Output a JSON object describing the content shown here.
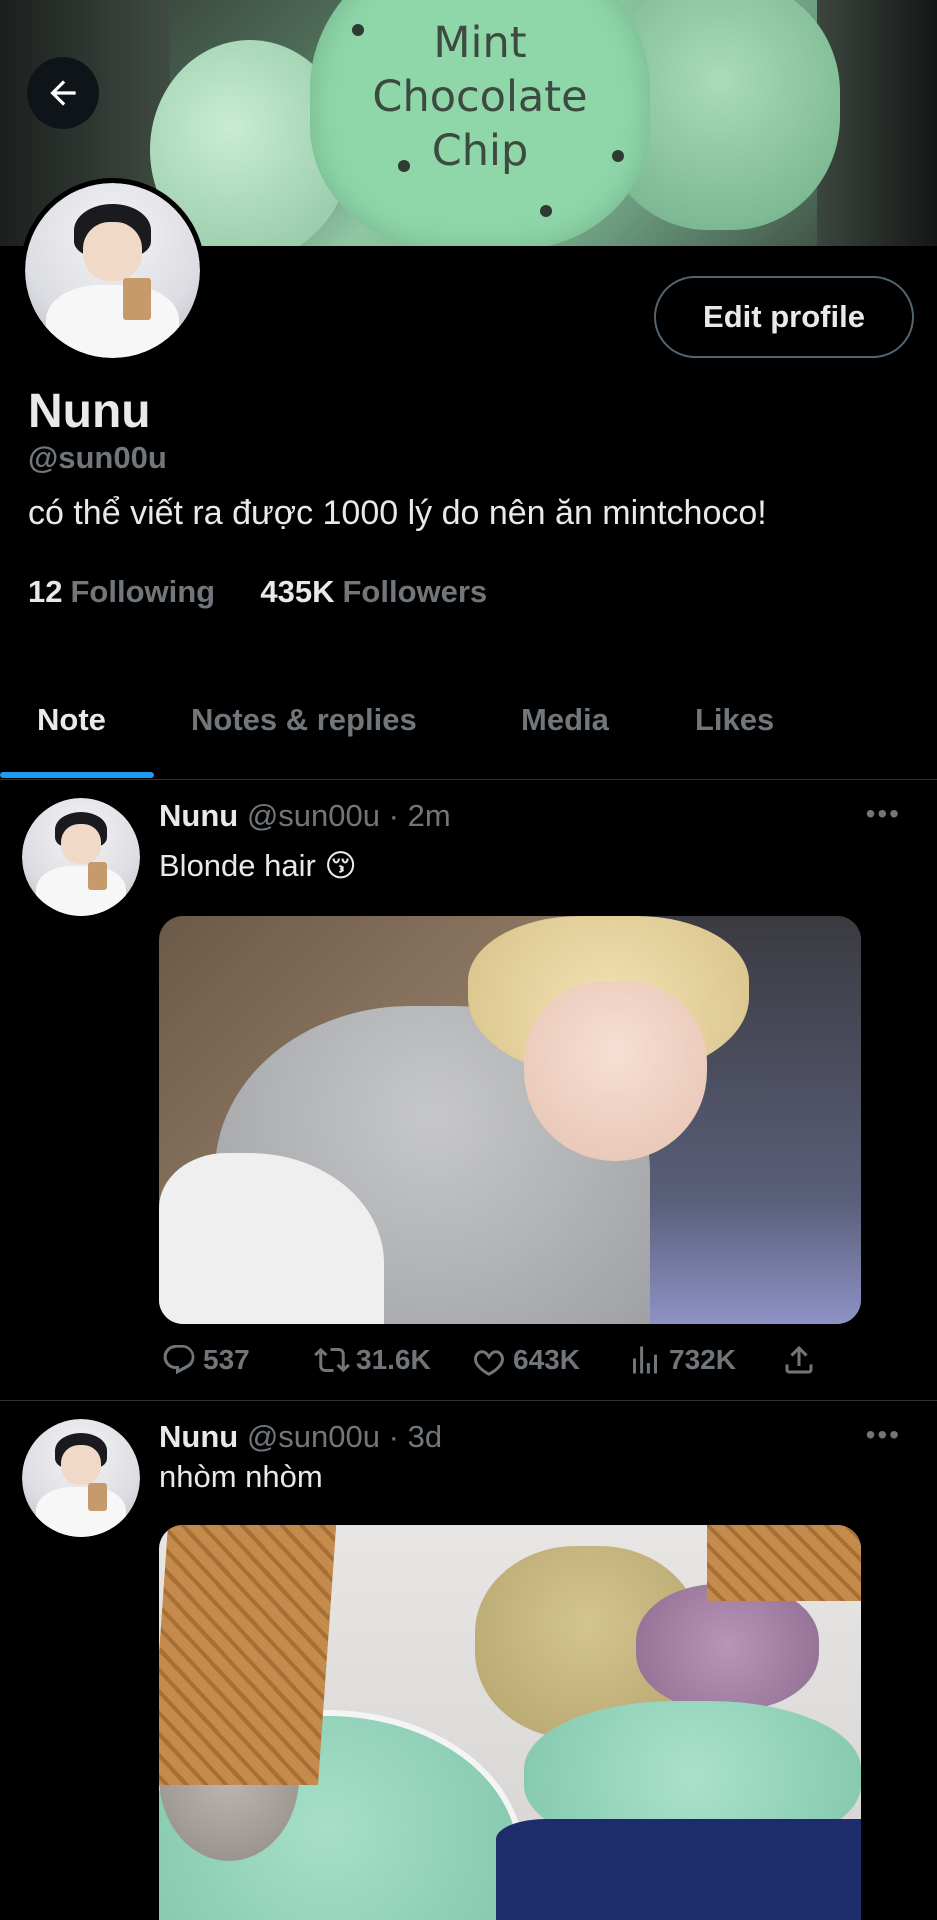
{
  "banner": {
    "sign_lines": [
      "Mint",
      "Chocolate",
      "Chip"
    ]
  },
  "header": {
    "back_icon": "arrow-left-icon"
  },
  "profile": {
    "name": "Nunu",
    "handle": "@sun00u",
    "bio": "có thể viết ra được 1000 lý do nên ăn mintchoco!",
    "edit_label": "Edit profile",
    "following_count": "12",
    "following_label": "Following",
    "followers_count": "435K",
    "followers_label": "Followers"
  },
  "tabs": [
    {
      "label": "Note",
      "active": true
    },
    {
      "label": "Notes & replies",
      "active": false
    },
    {
      "label": "Media",
      "active": false
    },
    {
      "label": "Likes",
      "active": false
    }
  ],
  "posts": [
    {
      "author": "Nunu",
      "handle": "@sun00u",
      "time": "2m",
      "text": "Blonde hair 😚",
      "replies": "537",
      "reposts": "31.6K",
      "likes": "643K",
      "views": "732K"
    },
    {
      "author": "Nunu",
      "handle": "@sun00u",
      "time": "3d",
      "text": "nhòm nhòm"
    }
  ],
  "colors": {
    "background": "#000000",
    "text": "#e7e9ea",
    "muted": "#71767b",
    "accent": "#1d9bf0",
    "divider": "#2f3336"
  }
}
